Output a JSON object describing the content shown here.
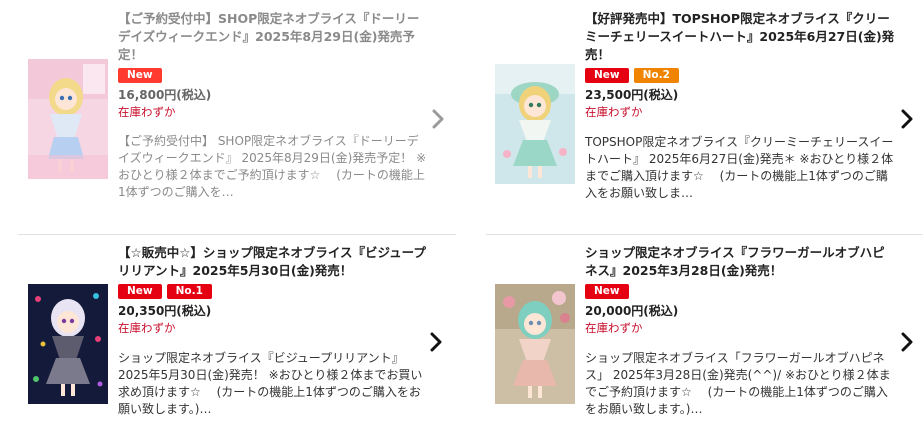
{
  "products": [
    {
      "title": "【ご予約受付中】SHOP限定ネオブライス『ドーリーデイズウィークエンド』2025年8月29日(金)発売予定！",
      "badges": [
        {
          "label": "New",
          "color": "#ff3b30"
        }
      ],
      "price": "16,800円(税込)",
      "stock": "在庫わずか",
      "description": "【ご予約受付中】 SHOP限定ネオブライス『ドーリーデイズウィークエンド』 2025年8月29日(金)発売予定！ ※おひとり様２体までご予約頂けます☆ 　(カートの機能上1体ずつのご購入を…",
      "chevron_icon": "chevron-right-icon",
      "image_icon": "doll-photo-icon"
    },
    {
      "title": "【好評発売中】TOPSHOP限定ネオブライス『クリーミーチェリースイートハート』2025年6月27日(金)発売！",
      "badges": [
        {
          "label": "New",
          "color": "#e50012"
        },
        {
          "label": "No.2",
          "color": "#f08300"
        }
      ],
      "price": "23,500円(税込)",
      "stock": "在庫わずか",
      "description": "TOPSHOP限定ネオブライス『クリーミーチェリースイートハート』 2025年6月27日(金)発売＊ ※おひとり様２体までご購入頂けます☆ 　(カートの機能上1体ずつのご購入をお願い致しま…",
      "chevron_icon": "chevron-right-icon",
      "image_icon": "doll-photo-icon"
    },
    {
      "title": "【☆販売中☆】ショップ限定ネオブライス『ビジュープリリアント』2025年5月30日(金)発売！",
      "badges": [
        {
          "label": "New",
          "color": "#e50012"
        },
        {
          "label": "No.1",
          "color": "#e50012"
        }
      ],
      "price": "20,350円(税込)",
      "stock": "在庫わずか",
      "description": "ショップ限定ネオブライス『ビジュープリリアント』 2025年5月30日(金)発売！ ※おひとり様２体までお買い求め頂けます☆ 　(カートの機能上1体ずつのご購入をお願い致します。)…",
      "chevron_icon": "chevron-right-icon",
      "image_icon": "doll-photo-icon"
    },
    {
      "title": "ショップ限定ネオブライス『フラワーガールオブハピネス』2025年3月28日(金)発売！",
      "badges": [
        {
          "label": "New",
          "color": "#e50012"
        }
      ],
      "price": "20,000円(税込)",
      "stock": "在庫わずか",
      "description": "ショップ限定ネオブライス「フラワーガールオブハピネス」 2025年3月28日(金)発売(^^)/ ※おひとり様２体までご予約頂けます☆ 　(カートの機能上1体ずつのご購入をお願い致します。)…",
      "chevron_icon": "chevron-right-icon",
      "image_icon": "doll-photo-icon"
    }
  ]
}
